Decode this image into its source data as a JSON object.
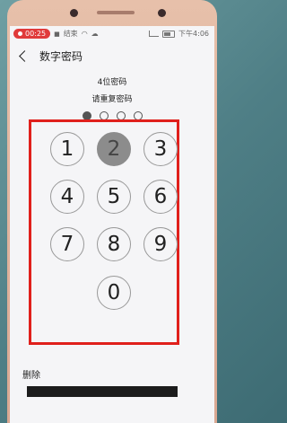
{
  "status_bar": {
    "time_pill": "00:25",
    "end_label": "结束",
    "clock": "下午4:06"
  },
  "header": {
    "title": "数字密码"
  },
  "prompt": {
    "line1": "4位密码",
    "line2": "请重复密码"
  },
  "pin_progress": {
    "filled": 1,
    "total": 4
  },
  "keypad": {
    "keys": [
      "1",
      "2",
      "3",
      "4",
      "5",
      "6",
      "7",
      "8",
      "9",
      "0"
    ],
    "pressed_key": "2"
  },
  "footer": {
    "delete_label": "删除"
  },
  "colors": {
    "highlight_box": "#e0201c",
    "recording_pill": "#e03b3b"
  }
}
